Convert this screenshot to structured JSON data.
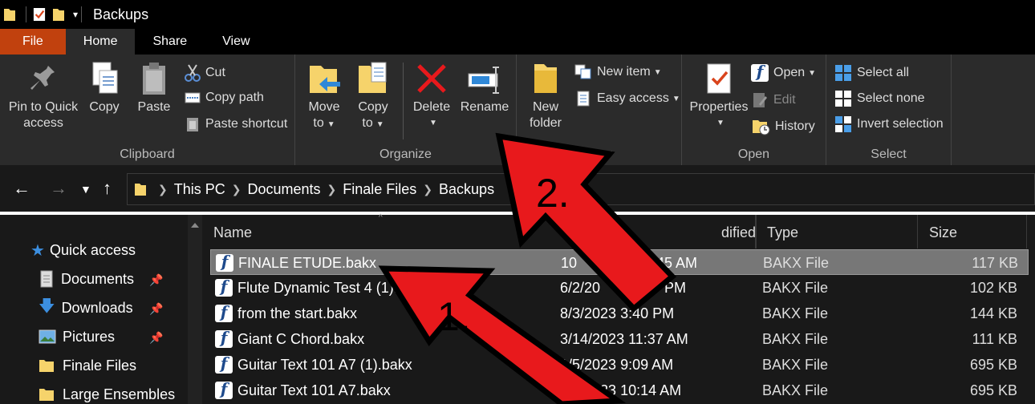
{
  "window": {
    "title": "Backups"
  },
  "tabs": [
    "File",
    "Home",
    "Share",
    "View"
  ],
  "ribbon": {
    "clipboard": {
      "label": "Clipboard",
      "pin_line1": "Pin to Quick",
      "pin_line2": "access",
      "copy": "Copy",
      "paste": "Paste",
      "cut": "Cut",
      "copy_path": "Copy path",
      "paste_shortcut": "Paste shortcut"
    },
    "organize": {
      "label": "Organize",
      "move_line1": "Move",
      "move_line2": "to",
      "copy_line1": "Copy",
      "copy_line2": "to",
      "delete": "Delete",
      "rename": "Rename"
    },
    "new": {
      "label": "New",
      "folder_line1": "New",
      "folder_line2": "folder",
      "new_item": "New item",
      "easy_access": "Easy access"
    },
    "open": {
      "label": "Open",
      "properties": "Properties",
      "open": "Open",
      "edit": "Edit",
      "history": "History"
    },
    "select": {
      "label": "Select",
      "select_all": "Select all",
      "select_none": "Select none",
      "invert": "Invert selection"
    }
  },
  "breadcrumb": [
    "This PC",
    "Documents",
    "Finale Files",
    "Backups"
  ],
  "nav": {
    "quick_access": "Quick access",
    "items": [
      {
        "label": "Documents",
        "pinned": true
      },
      {
        "label": "Downloads",
        "pinned": true
      },
      {
        "label": "Pictures",
        "pinned": true
      },
      {
        "label": "Finale Files",
        "pinned": false
      },
      {
        "label": "Large Ensembles",
        "pinned": false
      }
    ]
  },
  "columns": {
    "name": "Name",
    "modified": "dified",
    "type": "Type",
    "size": "Size"
  },
  "files": [
    {
      "name": "FINALE ETUDE.bakx",
      "date": "10",
      "date2": "1:45 AM",
      "type": "BAKX File",
      "size": "117 KB",
      "selected": true
    },
    {
      "name": "Flute Dynamic Test 4 (1).",
      "date": "6/2/20",
      "date2": "PM",
      "type": "BAKX File",
      "size": "102 KB"
    },
    {
      "name": "from the start.bakx",
      "date": "8/3/2023 3:40 PM",
      "date2": "",
      "type": "BAKX File",
      "size": "144 KB"
    },
    {
      "name": "Giant C Chord.bakx",
      "date": "3/14/2023 11:37 AM",
      "date2": "",
      "type": "BAKX File",
      "size": "111 KB"
    },
    {
      "name": "Guitar Text 101 A7 (1).bakx",
      "date": "1/5/2023 9:09 AM",
      "date2": "",
      "type": "BAKX File",
      "size": "695 KB"
    },
    {
      "name": "Guitar Text 101 A7.bakx",
      "date": "1/3/2023 10:14 AM",
      "date2": "",
      "type": "BAKX File",
      "size": "695 KB"
    }
  ],
  "annotations": {
    "step1": "1.",
    "step2": "2."
  },
  "colors": {
    "file_tab": "#c1410e",
    "arrow": "#e8191c",
    "selection": "#777777"
  }
}
